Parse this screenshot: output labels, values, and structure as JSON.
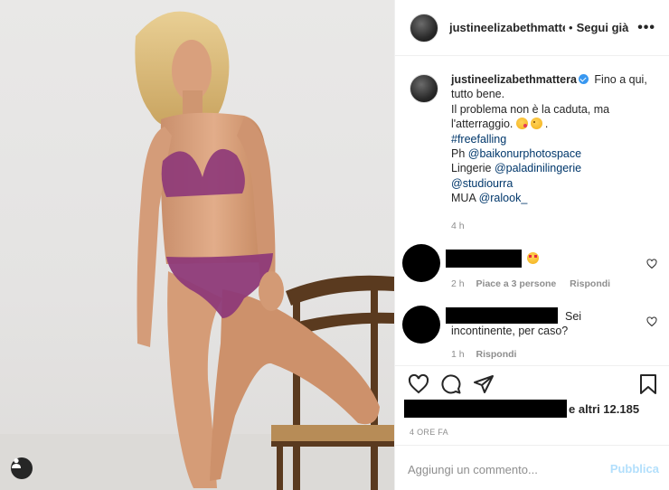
{
  "header": {
    "username": "justineelizabethmatte…",
    "separator": "•",
    "follow_label": "Segui già",
    "more_icon": "ellipsis-icon"
  },
  "caption": {
    "username": "justineelizabethmattera",
    "line1": "Fino a qui, tutto bene.",
    "line2": "Il problema non è la caduta, ma l'atterraggio.",
    "hashtag": "#freefalling",
    "ph_prefix": "Ph",
    "ph_mention": "@baikonurphotospace",
    "lingerie_prefix": "Lingerie",
    "lingerie_mention": "@paladinilingerie",
    "studio_mention": "@studiourra",
    "mua_prefix": "MUA",
    "mua_mention": "@ralook_",
    "time": "4 h"
  },
  "comments": [
    {
      "time": "2 h",
      "likes": "Piace a 3 persone",
      "reply": "Rispondi",
      "text": ""
    },
    {
      "time": "1 h",
      "likes": "",
      "reply": "Rispondi",
      "text": "Sei incontinente, per caso?"
    }
  ],
  "likes": {
    "others": "e altri 12.185"
  },
  "date": "4 ORE FA",
  "add_comment": {
    "placeholder": "Aggiungi un commento...",
    "post_label": "Pubblica"
  },
  "colors": {
    "link": "#00376b",
    "muted": "#8e8e8e",
    "post_disabled": "#b2dffc",
    "verified": "#3897f0",
    "lingerie": "#8e3a78"
  }
}
